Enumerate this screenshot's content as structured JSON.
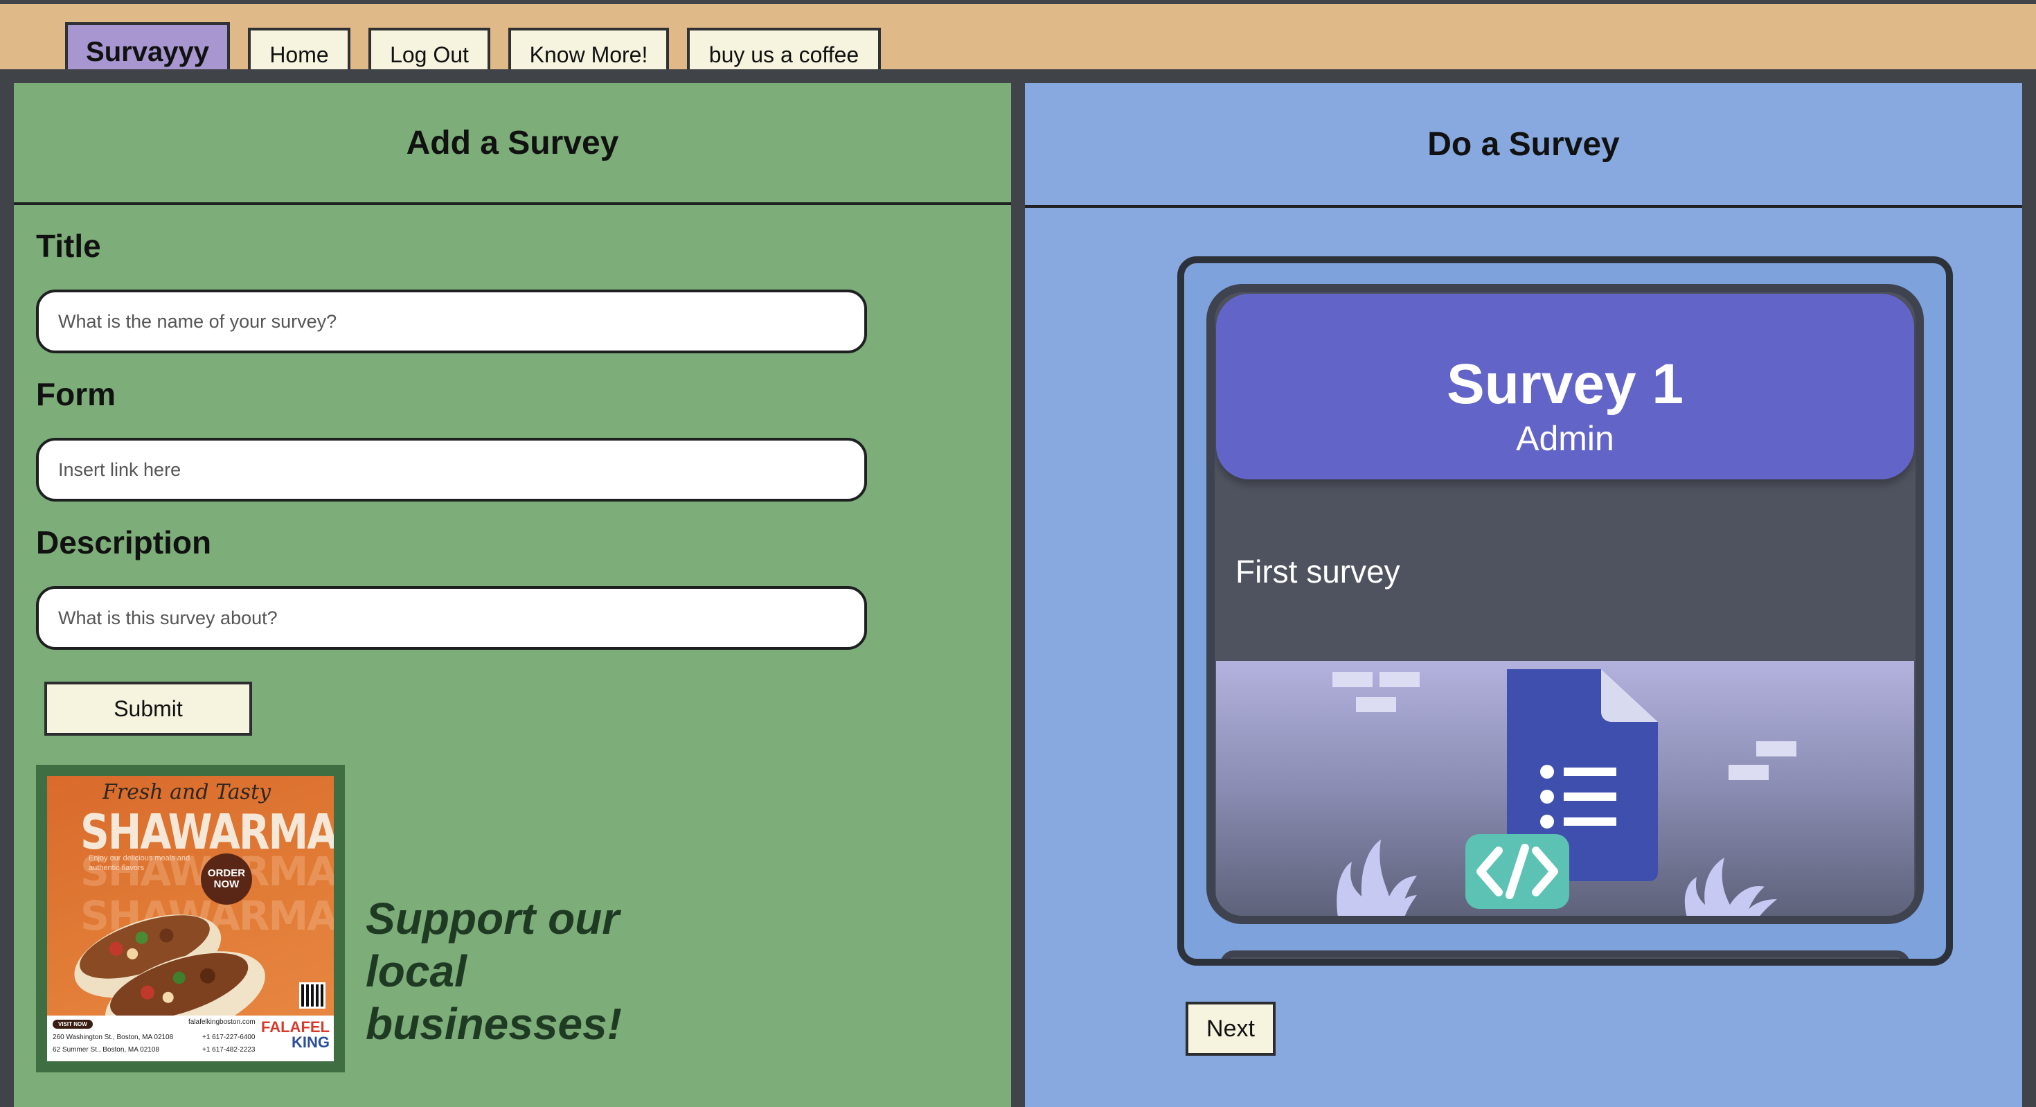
{
  "nav": {
    "brand": "Survayyy",
    "home": "Home",
    "logout": "Log Out",
    "know_more": "Know More!",
    "coffee": "buy us a coffee"
  },
  "add_survey": {
    "heading": "Add a Survey",
    "title_label": "Title",
    "title_placeholder": "What is the name of your survey?",
    "form_label": "Form",
    "form_placeholder": "Insert link here",
    "description_label": "Description",
    "description_placeholder": "What is this survey about?",
    "submit_label": "Submit"
  },
  "ad": {
    "script_text": "Fresh and Tasty",
    "title": "SHAWARMA",
    "blurb": "Enjoy our delicious meals and authentic flavors",
    "order_badge": "ORDER NOW",
    "visit_label": "VISIT NOW",
    "address_1": "260 Washington St., Boston, MA 02108",
    "address_2": "62 Summer St., Boston, MA 02108",
    "website": "falafelkingboston.com",
    "phone_1": "+1 617-227-6400",
    "phone_2": "+1 617-482-2223",
    "brand_top": "FALAFEL",
    "brand_bottom": "KING"
  },
  "support_text": "Support our local businesses!",
  "do_survey": {
    "heading": "Do a Survey",
    "card_title": "Survey 1",
    "card_author": "Admin",
    "card_description": "First survey",
    "next_label": "Next"
  },
  "colors": {
    "nav_bg": "#e0b988",
    "brand_bg": "#a796cf",
    "left_panel": "#7dad79",
    "right_panel": "#87a9e0",
    "card_header": "#6264c8",
    "card_body": "#4f535f",
    "button_bg": "#f6f4df",
    "docs_blue": "#3f4fae",
    "code_teal": "#5bc2b4"
  },
  "icons": [
    "google-forms-icon",
    "code-icon",
    "plant-icon"
  ]
}
